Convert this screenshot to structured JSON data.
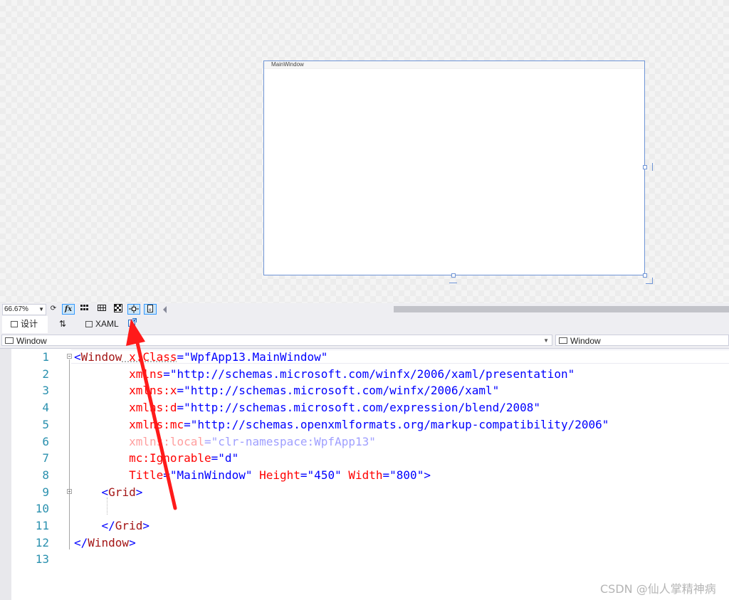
{
  "designer": {
    "window_title": "MainWindow"
  },
  "toolbar": {
    "zoom": "66.67%",
    "fx_label": "fx"
  },
  "view_tabs": {
    "design_label": "设计",
    "xaml_label": "XAML"
  },
  "navigation": {
    "left_element": "Window",
    "right_element": "Window"
  },
  "editor": {
    "lines": [
      {
        "n": "1",
        "tokens": [
          [
            "<",
            "punc"
          ],
          [
            "Window",
            "tag"
          ],
          [
            " x:Class",
            "attr"
          ],
          [
            "=",
            "punc"
          ],
          [
            "\"WpfApp13.MainWindow\"",
            "val"
          ]
        ]
      },
      {
        "n": "2",
        "tokens": [
          [
            "        xmlns",
            "attr"
          ],
          [
            "=",
            "punc"
          ],
          [
            "\"http://schemas.microsoft.com/winfx/2006/xaml/presentation\"",
            "val"
          ]
        ]
      },
      {
        "n": "3",
        "tokens": [
          [
            "        xmlns:x",
            "attr"
          ],
          [
            "=",
            "punc"
          ],
          [
            "\"http://schemas.microsoft.com/winfx/2006/xaml\"",
            "val"
          ]
        ]
      },
      {
        "n": "4",
        "tokens": [
          [
            "        xmlns:d",
            "attr"
          ],
          [
            "=",
            "punc"
          ],
          [
            "\"http://schemas.microsoft.com/expression/blend/2008\"",
            "val"
          ]
        ]
      },
      {
        "n": "5",
        "tokens": [
          [
            "        xmlns:mc",
            "attr"
          ],
          [
            "=",
            "punc"
          ],
          [
            "\"http://schemas.openxmlformats.org/markup-compatibility/2006\"",
            "val"
          ]
        ]
      },
      {
        "n": "6",
        "dim": true,
        "tokens": [
          [
            "        xmlns:local",
            "attr"
          ],
          [
            "=",
            "punc"
          ],
          [
            "\"clr-namespace:WpfApp13\"",
            "val"
          ]
        ]
      },
      {
        "n": "7",
        "tokens": [
          [
            "        mc:Ignorable",
            "attr"
          ],
          [
            "=",
            "punc"
          ],
          [
            "\"d\"",
            "val"
          ]
        ]
      },
      {
        "n": "8",
        "tokens": [
          [
            "        Title",
            "attr"
          ],
          [
            "=",
            "punc"
          ],
          [
            "\"MainWindow\"",
            "val"
          ],
          [
            " Height",
            "attr"
          ],
          [
            "=",
            "punc"
          ],
          [
            "\"450\"",
            "val"
          ],
          [
            " Width",
            "attr"
          ],
          [
            "=",
            "punc"
          ],
          [
            "\"800\"",
            "val"
          ],
          [
            ">",
            "punc"
          ]
        ]
      },
      {
        "n": "9",
        "tokens": [
          [
            "    <",
            "punc"
          ],
          [
            "Grid",
            "tag"
          ],
          [
            ">",
            "punc"
          ]
        ]
      },
      {
        "n": "10",
        "tokens": []
      },
      {
        "n": "11",
        "tokens": [
          [
            "    </",
            "punc"
          ],
          [
            "Grid",
            "tag"
          ],
          [
            ">",
            "punc"
          ]
        ]
      },
      {
        "n": "12",
        "tokens": [
          [
            "</",
            "punc"
          ],
          [
            "Window",
            "tag"
          ],
          [
            ">",
            "punc"
          ]
        ]
      },
      {
        "n": "13",
        "tokens": []
      }
    ]
  },
  "watermark": "CSDN @仙人掌精神病",
  "colors": {
    "accent": "#3399ff",
    "annotation_arrow": "#ff1a1a",
    "line_number": "#2b91af"
  }
}
